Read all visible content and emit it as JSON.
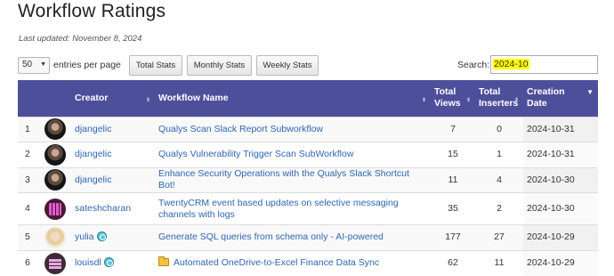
{
  "page": {
    "title": "Workflow Ratings",
    "last_updated": "Last updated: November 8, 2024"
  },
  "controls": {
    "per_page_value": "50",
    "per_page_label": "entries per page",
    "buttons": {
      "total": "Total Stats",
      "monthly": "Monthly Stats",
      "weekly": "Weekly Stats"
    },
    "search_label": "Search:",
    "search_value": "2024-10"
  },
  "table": {
    "headers": {
      "creator": "Creator",
      "workflow": "Workflow Name",
      "views_1": "Total",
      "views_2": "Views",
      "inserters_1": "Total",
      "inserters_2": "Inserters",
      "date_1": "Creation",
      "date_2": "Date"
    },
    "sort_icons": {
      "neutral": "⬍",
      "descending": "▼"
    },
    "rows": [
      {
        "rank": "1",
        "avatar": "avatar-dark-portrait",
        "creator": "djangelic",
        "verified": false,
        "folder": false,
        "workflow": "Qualys Scan Slack Report Subworkflow",
        "views": "7",
        "inserters": "0",
        "date": "2024-10-31"
      },
      {
        "rank": "2",
        "avatar": "avatar-dark-portrait",
        "creator": "djangelic",
        "verified": false,
        "folder": false,
        "workflow": "Qualys Vulnerability Trigger Scan SubWorkflow",
        "views": "15",
        "inserters": "1",
        "date": "2024-10-31"
      },
      {
        "rank": "3",
        "avatar": "avatar-dark-portrait",
        "creator": "djangelic",
        "verified": false,
        "folder": false,
        "workflow": "Enhance Security Operations with the Qualys Slack Shortcut Bot!",
        "views": "11",
        "inserters": "4",
        "date": "2024-10-30"
      },
      {
        "rank": "4",
        "avatar": "avatar-pink-pattern",
        "creator": "sateshcharan",
        "verified": false,
        "folder": false,
        "workflow": "TwentyCRM event based updates on selective messaging channels with logs",
        "views": "35",
        "inserters": "2",
        "date": "2024-10-30"
      },
      {
        "rank": "5",
        "avatar": "avatar-blonde-portrait",
        "creator": "yulia",
        "verified": true,
        "folder": false,
        "workflow": "Generate SQL queries from schema only - AI-powered",
        "views": "177",
        "inserters": "27",
        "date": "2024-10-29"
      },
      {
        "rank": "6",
        "avatar": "avatar-lavender-pattern",
        "creator": "louisdl",
        "verified": true,
        "folder": true,
        "workflow": "Automated OneDrive-to-Excel Finance Data Sync",
        "views": "62",
        "inserters": "11",
        "date": "2024-10-29"
      }
    ]
  }
}
